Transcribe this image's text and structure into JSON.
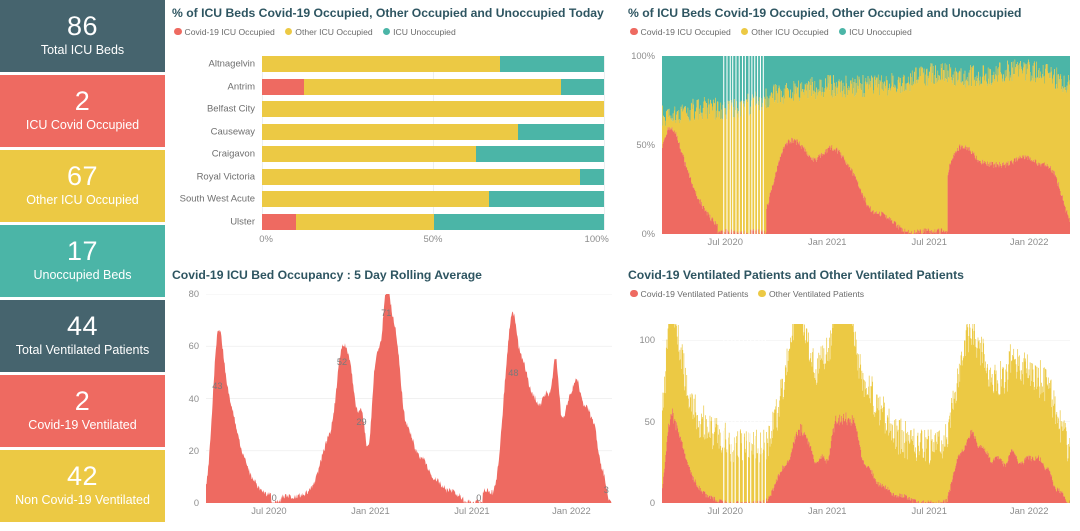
{
  "colors": {
    "dark_teal": "#46646e",
    "red": "#ee6a61",
    "yellow": "#ecc944",
    "teal": "#4bb5a7",
    "title": "#2e5561",
    "axis_text": "#8d8d8d",
    "grid": "#ededed"
  },
  "kpi_cards": [
    {
      "value": "86",
      "label": "Total ICU Beds",
      "color": "#46646e"
    },
    {
      "value": "2",
      "label": "ICU Covid Occupied",
      "color": "#ee6a61"
    },
    {
      "value": "67",
      "label": "Other ICU Occupied",
      "color": "#ecc944"
    },
    {
      "value": "17",
      "label": "Unoccupied Beds",
      "color": "#4bb5a7"
    },
    {
      "value": "44",
      "label": "Total Ventilated Patients",
      "color": "#46646e"
    },
    {
      "value": "2",
      "label": "Covid-19 Ventilated",
      "color": "#ee6a61"
    },
    {
      "value": "42",
      "label": "Non Covid-19 Ventilated",
      "color": "#ecc944"
    }
  ],
  "panel_bars": {
    "title": "% of ICU Beds Covid-19 Occupied, Other Occupied and Unoccupied Today",
    "legend": [
      {
        "label": "Covid-19 ICU Occupied",
        "color": "#ee6a61"
      },
      {
        "label": "Other ICU Occupied",
        "color": "#ecc944"
      },
      {
        "label": "ICU Unoccupied",
        "color": "#4bb5a7"
      }
    ]
  },
  "panel_pct_series": {
    "title": "% of ICU Beds Covid-19 Occupied, Other Occupied and Unoccupied",
    "legend": [
      {
        "label": "Covid-19 ICU Occupied",
        "color": "#ee6a61"
      },
      {
        "label": "Other ICU Occupied",
        "color": "#ecc944"
      },
      {
        "label": "ICU Unoccupied",
        "color": "#4bb5a7"
      }
    ]
  },
  "panel_rolling": {
    "title": "Covid-19 ICU Bed Occupancy : 5 Day Rolling Average"
  },
  "panel_vent": {
    "title": "Covid-19 Ventilated Patients and Other Ventilated Patients",
    "legend": [
      {
        "label": "Covid-19 Ventilated Patients",
        "color": "#ee6a61"
      },
      {
        "label": "Other Ventilated Patients",
        "color": "#ecc944"
      }
    ]
  },
  "chart_data": [
    {
      "id": "icu_beds_today_by_hospital",
      "type": "bar",
      "orientation": "horizontal",
      "stacked": true,
      "normalized": true,
      "title": "% of ICU Beds Covid-19 Occupied, Other Occupied and Unoccupied Today",
      "xlabel": "",
      "ylabel": "",
      "xlim": [
        0,
        100
      ],
      "xticks": [
        "0%",
        "50%",
        "100%"
      ],
      "xtick_values": [
        0,
        50,
        100
      ],
      "grid": true,
      "legend_position": "top-left",
      "categories": [
        "Altnagelvin",
        "Antrim",
        "Belfast City",
        "Causeway",
        "Craigavon",
        "Royal Victoria",
        "South West Acute",
        "Ulster"
      ],
      "series": [
        {
          "name": "Covid-19 ICU Occupied",
          "color": "#ee6a61",
          "values": [
            0,
            12.4,
            0,
            0,
            0,
            0,
            0,
            9.8
          ]
        },
        {
          "name": "Other ICU Occupied",
          "color": "#ecc944",
          "values": [
            69.6,
            75.0,
            100,
            74.9,
            62.6,
            92.9,
            66.5,
            40.6
          ]
        },
        {
          "name": "ICU Unoccupied",
          "color": "#4bb5a7",
          "values": [
            30.4,
            12.6,
            0,
            25.1,
            37.4,
            7.1,
            33.5,
            49.6
          ]
        }
      ]
    },
    {
      "id": "icu_beds_pct_over_time",
      "type": "area",
      "stacked": true,
      "normalized": true,
      "title": "% of ICU Beds Covid-19 Occupied, Other Occupied and Unoccupied",
      "xlabel": "",
      "ylabel": "",
      "ylim": [
        0,
        100
      ],
      "yticks": [
        "0%",
        "50%",
        "100%"
      ],
      "ytick_values": [
        0,
        50,
        100
      ],
      "xticks": [
        "Jul 2020",
        "Jan 2021",
        "Jul 2021",
        "Jan 2022"
      ],
      "xtick_positions": [
        0.155,
        0.405,
        0.655,
        0.9
      ],
      "grid": false,
      "legend_position": "top-left",
      "series": [
        {
          "name": "Covid-19 ICU Occupied",
          "color": "#ee6a61"
        },
        {
          "name": "Other ICU Occupied",
          "color": "#ecc944"
        },
        {
          "name": "ICU Unoccupied",
          "color": "#4bb5a7"
        }
      ],
      "note": "Daily stacked 100% columns from approx Apr 2020 to Mar 2022. Covid share peaks near 45% around Nov 2020 and Jan 2021, and near 46% in Sep 2021, falling to near 0% across summer 2020 and early summer 2021."
    },
    {
      "id": "covid_icu_occupancy_5day_rolling",
      "type": "area",
      "stacked": false,
      "title": "Covid-19 ICU Bed Occupancy : 5 Day Rolling Average",
      "xlabel": "",
      "ylabel": "",
      "ylim": [
        0,
        80
      ],
      "yticks": [
        "0",
        "20",
        "40",
        "60",
        "80"
      ],
      "ytick_values": [
        0,
        20,
        40,
        60,
        80
      ],
      "xticks": [
        "Jul 2020",
        "Jan 2021",
        "Jul 2021",
        "Jan 2022"
      ],
      "xtick_positions": [
        0.155,
        0.405,
        0.655,
        0.9
      ],
      "grid": true,
      "series": [
        {
          "name": "Covid-19 ICU Bed Occupancy",
          "color": "#ee6a61"
        }
      ],
      "annotations": [
        {
          "label": "43",
          "x_frac": 0.028,
          "value": 43
        },
        {
          "label": "0",
          "x_frac": 0.168,
          "value": 0
        },
        {
          "label": "52",
          "x_frac": 0.335,
          "value": 52
        },
        {
          "label": "29",
          "x_frac": 0.383,
          "value": 29
        },
        {
          "label": "71",
          "x_frac": 0.444,
          "value": 71
        },
        {
          "label": "0",
          "x_frac": 0.672,
          "value": 0
        },
        {
          "label": "48",
          "x_frac": 0.757,
          "value": 48
        },
        {
          "label": "3",
          "x_frac": 0.986,
          "value": 3
        }
      ]
    },
    {
      "id": "ventilated_patients_over_time",
      "type": "area",
      "stacked": true,
      "title": "Covid-19 Ventilated Patients and Other Ventilated Patients",
      "xlabel": "",
      "ylabel": "",
      "ylim": [
        0,
        110
      ],
      "yticks": [
        "0",
        "50",
        "100"
      ],
      "ytick_values": [
        0,
        50,
        100
      ],
      "xticks": [
        "Jul 2020",
        "Jan 2021",
        "Jul 2021",
        "Jan 2022"
      ],
      "xtick_positions": [
        0.155,
        0.405,
        0.655,
        0.9
      ],
      "grid": true,
      "legend_position": "top-left",
      "series": [
        {
          "name": "Covid-19 Ventilated Patients",
          "color": "#ee6a61"
        },
        {
          "name": "Other Ventilated Patients",
          "color": "#ecc944"
        }
      ],
      "note": "Daily stacked totals peaking near 105 in Jan 2021; Covid component peaks near 60 in Jan 2021 and near 45 in Nov 2020."
    }
  ]
}
